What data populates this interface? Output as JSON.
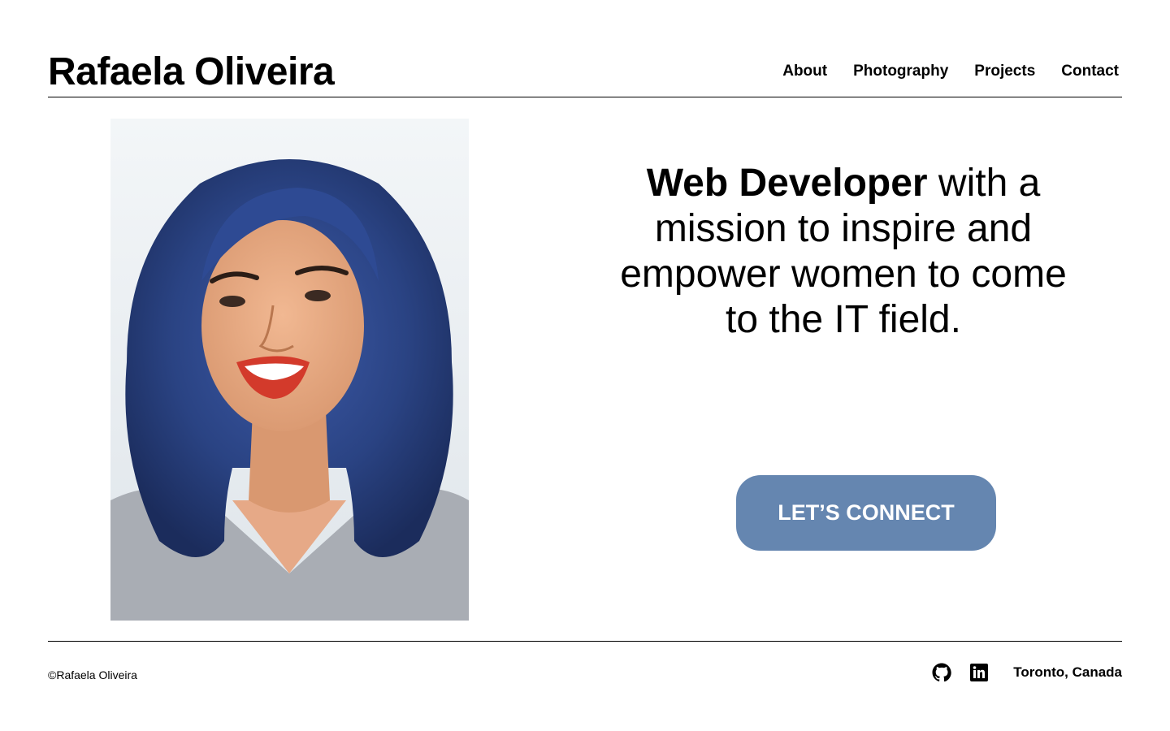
{
  "header": {
    "name": "Rafaela Oliveira",
    "nav": [
      {
        "label": "About"
      },
      {
        "label": "Photography"
      },
      {
        "label": "Projects"
      },
      {
        "label": "Contact"
      }
    ]
  },
  "hero": {
    "tagline_bold": "Web Developer",
    "tagline_rest": " with a mission to inspire and empower women to come to the IT field.",
    "cta_label": "LET’S CONNECT",
    "cta_color": "#6586b0",
    "photo_icon": "portrait-photo"
  },
  "footer": {
    "copyright_symbol": "©",
    "copyright_name": "Rafaela Oliveira",
    "social_icons": [
      "github-icon",
      "linkedin-icon"
    ],
    "location": "Toronto, Canada"
  }
}
